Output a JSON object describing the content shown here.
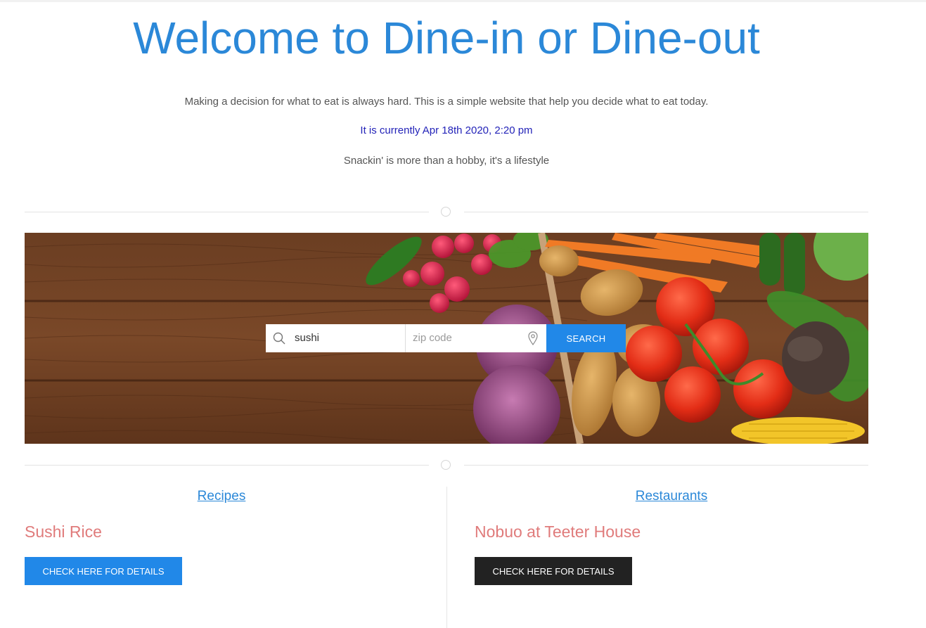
{
  "header": {
    "title": "Welcome to Dine-in or Dine-out",
    "intro": "Making a decision for what to eat is always hard. This is a simple website that help you decide what to eat today.",
    "current_time": "It is currently Apr 18th 2020, 2:20 pm",
    "tagline": "Snackin' is more than a hobby, it's a lifestyle"
  },
  "search": {
    "query_value": "sushi",
    "zip_placeholder": "zip code",
    "button_label": "SEARCH",
    "search_icon": "search-icon",
    "location_icon": "location-pin-icon"
  },
  "hero": {
    "image": "vegetables-on-wooden-table"
  },
  "recipes": {
    "heading": "Recipes",
    "item_title": "Sushi Rice",
    "button_label": "CHECK HERE FOR DETAILS"
  },
  "restaurants": {
    "heading": "Restaurants",
    "item_title": "Nobuo at Teeter House",
    "button_label": "CHECK HERE FOR DETAILS"
  },
  "colors": {
    "accent": "#2b88d8",
    "search_button": "#2188e8",
    "time_text": "#2323b8",
    "item_title": "#e07b7b",
    "dark_button": "#222222",
    "blue_button": "#2188e8"
  }
}
